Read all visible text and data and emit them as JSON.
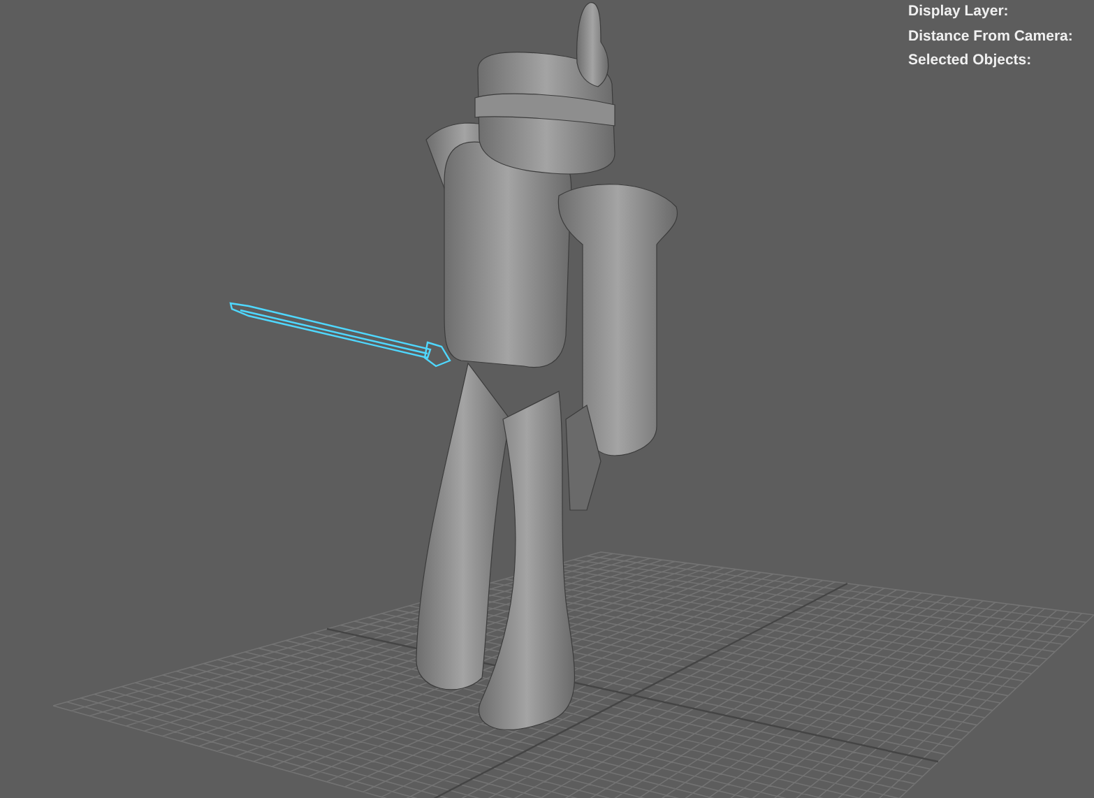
{
  "hud_labels": [
    {
      "text": "Display Layer:"
    },
    {
      "text": "Distance From Camera:"
    },
    {
      "text": "Selected Objects:"
    }
  ],
  "viewport": {
    "objects": [
      {
        "kind": "character",
        "selected": false
      },
      {
        "kind": "sword",
        "selected": true
      }
    ]
  }
}
